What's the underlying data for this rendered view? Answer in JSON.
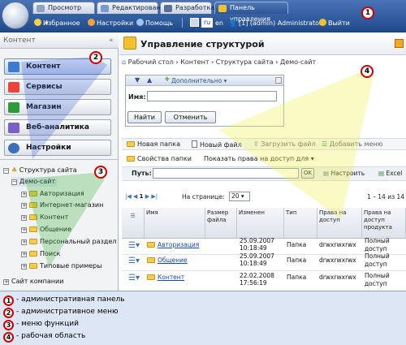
{
  "topbar": {
    "tabs": [
      "Просмотр",
      "Редактирование",
      "Разработка",
      "Панель управления"
    ],
    "favorites": "Избранное",
    "settings": "Настройки",
    "help": "Помощь",
    "lang_ru": "ru",
    "lang_en": "en",
    "user": "[1] (admin) Administrator",
    "logout": "Выйти"
  },
  "left": {
    "title": "Контент",
    "menu": [
      "Контент",
      "Сервисы",
      "Магазин",
      "Веб-аналитика",
      "Настройки"
    ],
    "tree_root": "Структура сайта",
    "tree_site": "Демо-сайт",
    "tree_items": [
      "Авторизация",
      "Интернет-магазин",
      "Контент",
      "Общение",
      "Персональный раздел",
      "Поиск",
      "Типовые примеры"
    ],
    "tree_company": "Сайт компании"
  },
  "main": {
    "title": "Управление структурой",
    "breadcrumb": [
      "Рабочий стол",
      "Контент",
      "Структура сайта",
      "Демо-сайт"
    ],
    "filter_more": "Дополнительно",
    "name_label": "Имя:",
    "find": "Найти",
    "cancel": "Отменить",
    "toolbar1": [
      "Новая папка",
      "Новый файл",
      "Загрузить файл",
      "Добавить меню"
    ],
    "toolbar2": [
      "Свойства папки",
      "Показать права на доступ для"
    ],
    "path_label": "Путь:",
    "ok": "OK",
    "configure": "Настроить",
    "excel": "Excel",
    "page_num": "1",
    "per_page_label": "На странице:",
    "per_page": "20",
    "range": "1 – 14 из 14",
    "columns": [
      "Имя",
      "Размер файла",
      "Изменен",
      "Тип",
      "Права на доступ",
      "Права на доступ продукта"
    ],
    "rows": [
      {
        "name": "Авторизация",
        "date": "25.09.2007",
        "time": "10:18:49",
        "type": "Папка",
        "perm": "drwxrwxrwx",
        "product": "Полный доступ"
      },
      {
        "name": "Общение",
        "date": "25.09.2007",
        "time": "10:18:49",
        "type": "Папка",
        "perm": "drwxrwxrwx",
        "product": "Полный доступ"
      },
      {
        "name": "Контент",
        "date": "22.02.2008",
        "time": "17:56:19",
        "type": "Папка",
        "perm": "drwxrwxrwx",
        "product": "Полный доступ"
      }
    ]
  },
  "markers": [
    "1",
    "2",
    "3",
    "4"
  ],
  "legend": [
    {
      "num": "1",
      "text": "- административная панель"
    },
    {
      "num": "2",
      "text": "- административное меню"
    },
    {
      "num": "3",
      "text": "- меню функций"
    },
    {
      "num": "4",
      "text": "- рабочая область"
    }
  ]
}
